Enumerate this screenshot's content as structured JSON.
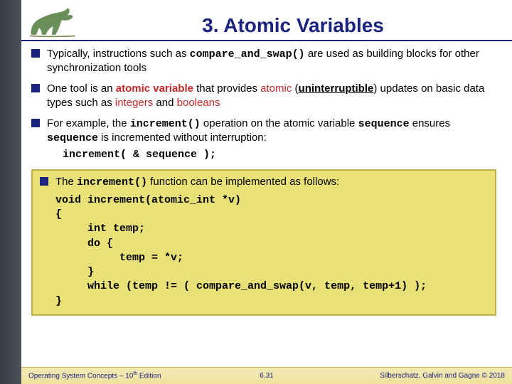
{
  "title": "3. Atomic Variables",
  "bullets": {
    "b1a": "Typically, instructions such as ",
    "b1_code": "compare_and_swap()",
    "b1b": " are used as building blocks for other synchronization tools",
    "b2a": "One tool is an ",
    "b2_av": "atomic variable",
    "b2b": " that provides ",
    "b2_atomic": "atomic",
    "b2c": " (",
    "b2_unint": "uninterruptible",
    "b2d": ") updates on basic data types such as ",
    "b2_int": "integers",
    "b2e": " and ",
    "b2_bool": "booleans",
    "b3a": "For example, the ",
    "b3_inc": "increment()",
    "b3b": " operation on the atomic variable ",
    "b3_seq1": "sequence",
    "b3c": " ensures ",
    "b3_seq2": "sequence",
    "b3d": " is incremented without interruption:",
    "b3_code": "increment( & sequence );",
    "b4a": "The ",
    "b4_inc": "increment()",
    "b4b": " function can be implemented as follows:"
  },
  "impl": {
    "l1": "void increment(atomic_int *v)",
    "l2": "{",
    "l3": "     int temp;",
    "l4": "     do {",
    "l5": "          temp = *v;",
    "l6": "     }",
    "l7": "     while (temp != ( compare_and_swap(v, temp, temp+1) );",
    "l8": "}"
  },
  "footer": {
    "left_a": "Operating System Concepts – 10",
    "left_sup": "th",
    "left_b": " Edition",
    "center": "6.31",
    "right": "Silberschatz, Galvin and Gagne © 2018"
  }
}
